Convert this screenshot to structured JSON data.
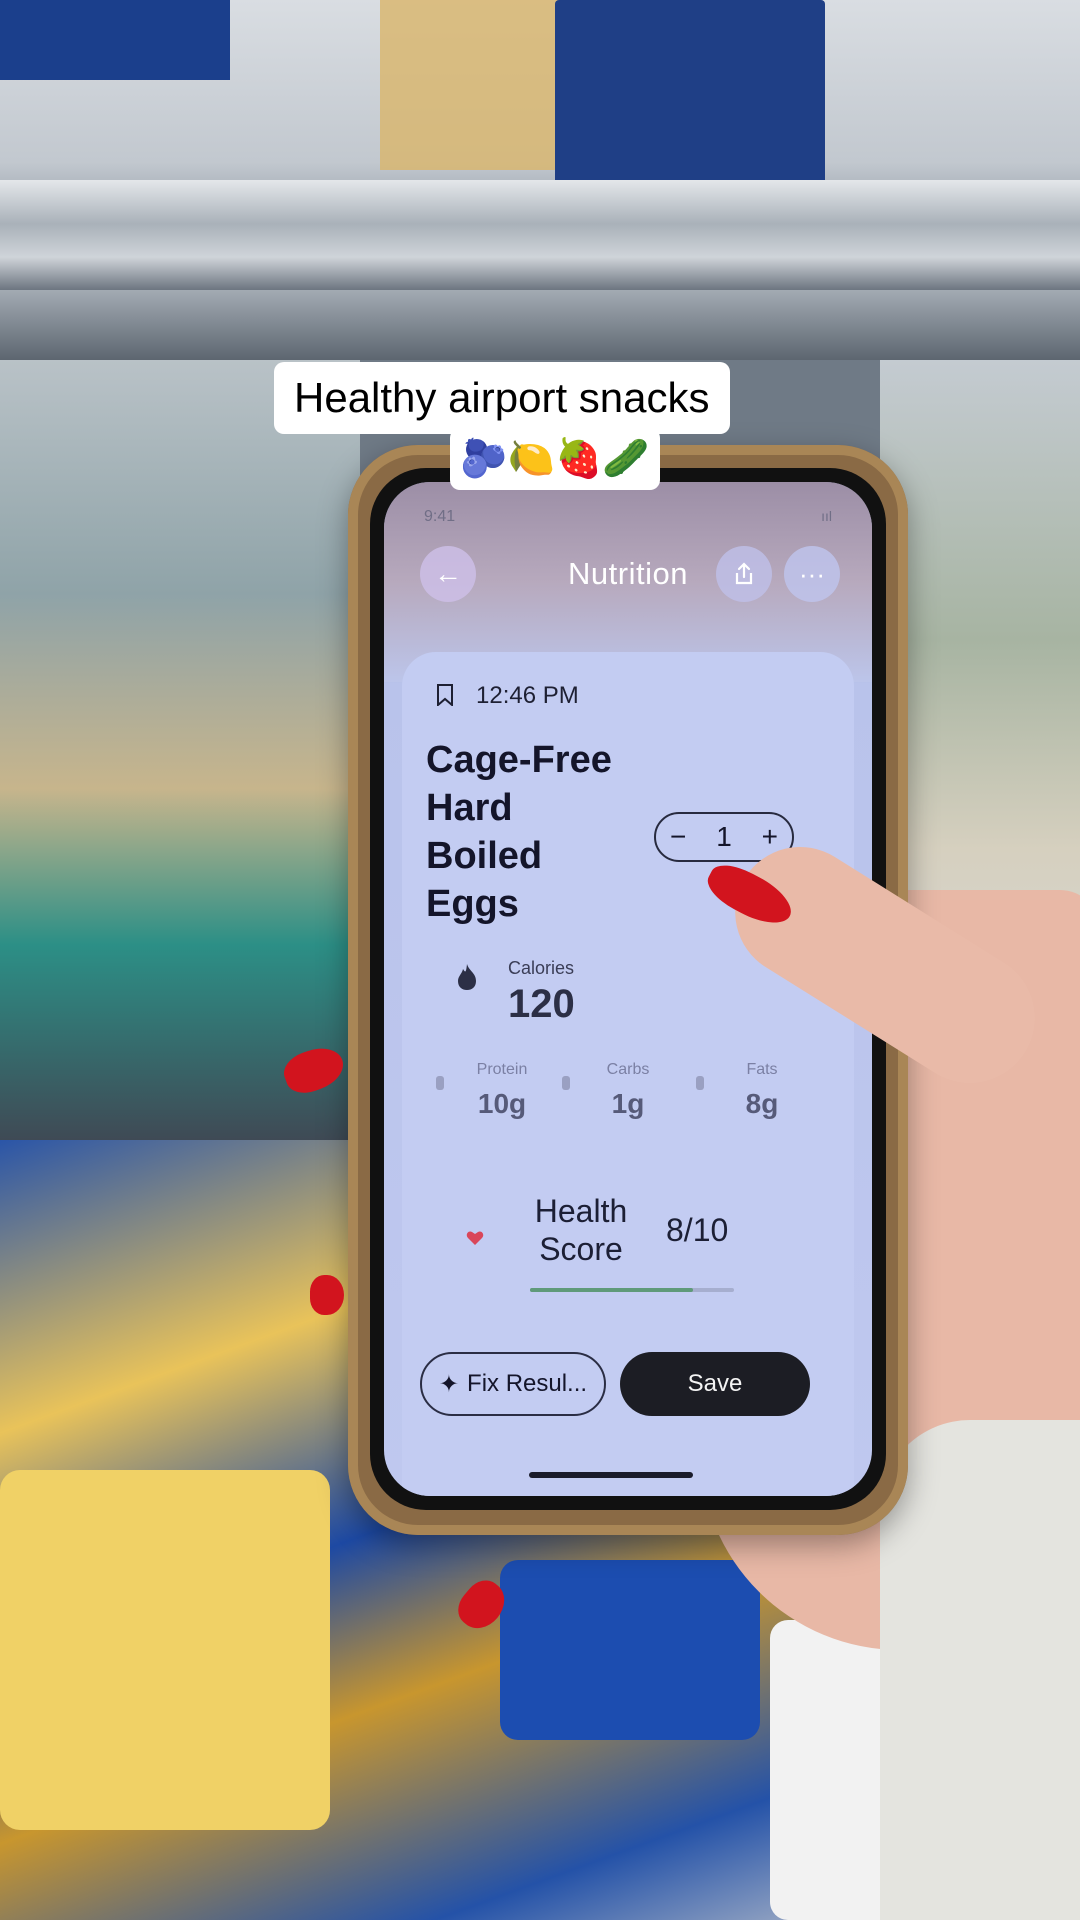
{
  "caption": {
    "line1": "Healthy airport snacks",
    "line2": "🫐🍋🍓🥒"
  },
  "status_bar": {
    "time": "9:41",
    "right": "ııl"
  },
  "nav": {
    "back_icon": "←",
    "title": "Nutrition",
    "more_icon": "···"
  },
  "entry": {
    "time": "12:46 PM",
    "food_name": "Cage-Free Hard Boiled Eggs",
    "quantity": {
      "minus": "−",
      "value": "1",
      "plus": "+"
    }
  },
  "calories": {
    "label": "Calories",
    "value": "120"
  },
  "macros": [
    {
      "label": "Protein",
      "value": "10g"
    },
    {
      "label": "Carbs",
      "value": "1g"
    },
    {
      "label": "Fats",
      "value": "8g"
    }
  ],
  "health_score": {
    "label": "Health Score",
    "value": "8/10",
    "fraction": 0.8,
    "bar_color": "#5f9a7a"
  },
  "actions": {
    "fix_icon": "✦",
    "fix_label": "Fix Resul...",
    "save_label": "Save"
  },
  "colors": {
    "nail": "#d2141e",
    "card": "#c3ccf2"
  }
}
